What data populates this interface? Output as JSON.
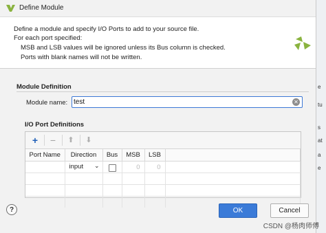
{
  "window": {
    "title": "Define Module",
    "logo_icon": "vivado-logo-icon"
  },
  "header": {
    "lines": [
      "Define a module and specify I/O Ports to add to your source file.",
      "For each port specified:",
      "MSB and LSB values will be ignored unless its Bus column is checked.",
      "Ports with blank names will not be written."
    ]
  },
  "module_definition": {
    "heading": "Module Definition",
    "name_label": "Module name:",
    "name_value": "test"
  },
  "ports": {
    "heading": "I/O Port Definitions",
    "toolbar": {
      "add": "+",
      "remove": "−",
      "up": "⬆",
      "down": "⬇"
    },
    "columns": [
      "Port Name",
      "Direction",
      "Bus",
      "MSB",
      "LSB"
    ],
    "rows": [
      {
        "port_name": "",
        "direction": "input",
        "bus": false,
        "msb": "0",
        "lsb": "0"
      }
    ]
  },
  "buttons": {
    "help": "?",
    "ok": "OK",
    "cancel": "Cancel"
  },
  "background_peek": [
    "e",
    "tu",
    "s",
    "at",
    "a",
    "e"
  ],
  "watermark": "CSDN @杨肉师傅",
  "colors": {
    "accent": "#3b7bd8",
    "logo_green": "#8ab33f"
  }
}
